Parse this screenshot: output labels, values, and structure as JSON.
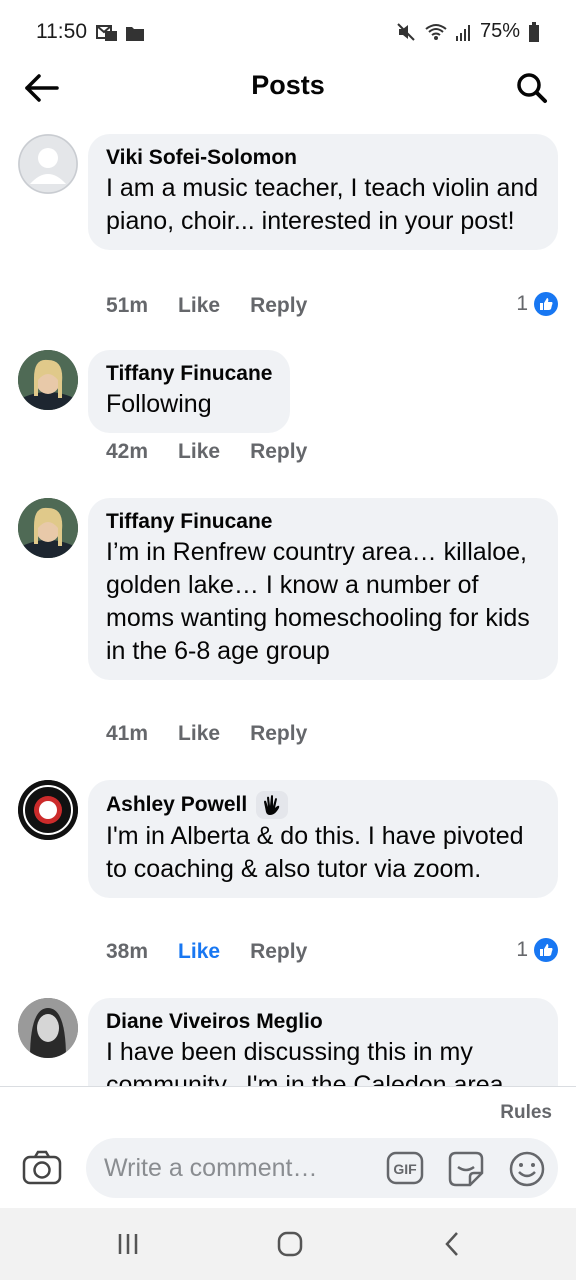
{
  "status_bar": {
    "time": "11:50",
    "battery": "75%"
  },
  "header": {
    "title": "Posts"
  },
  "comments": [
    {
      "author": "Viki Sofei-Solomon",
      "text": "I am a music teacher, I teach violin and piano, choir... interested in your post!",
      "time": "51m",
      "like_label": "Like",
      "reply_label": "Reply",
      "reaction_count": "1",
      "liked": false,
      "avatar": "default-avatar"
    },
    {
      "author": "Tiffany Finucane",
      "text": "Following",
      "time": "42m",
      "like_label": "Like",
      "reply_label": "Reply",
      "reaction_count": "",
      "liked": false,
      "avatar": "profile-photo"
    },
    {
      "author": "Tiffany Finucane",
      "text": "I’m in Renfrew country area… killaloe, golden lake… I know a number of moms wanting homeschooling for kids in the 6-8 age group",
      "time": "41m",
      "like_label": "Like",
      "reply_label": "Reply",
      "reaction_count": "",
      "liked": false,
      "avatar": "profile-photo"
    },
    {
      "author": "Ashley Powell",
      "text": "I'm in Alberta & do this. I have pivoted to coaching & also tutor via zoom.",
      "time": "38m",
      "like_label": "Like",
      "reply_label": "Reply",
      "reaction_count": "1",
      "liked": true,
      "avatar": "badge-photo",
      "badge": "wave-icon"
    },
    {
      "author": "Diane Viveiros Meglio",
      "text": "I have been discussing this in my community...I'm in the Caledon area",
      "time": "",
      "avatar": "profile-photo"
    }
  ],
  "composer": {
    "rules_label": "Rules",
    "placeholder": "Write a comment…",
    "gif_label": "GIF"
  },
  "colors": {
    "accent": "#1877f2",
    "bubble": "#f0f2f5",
    "secondary_text": "#65676b"
  }
}
